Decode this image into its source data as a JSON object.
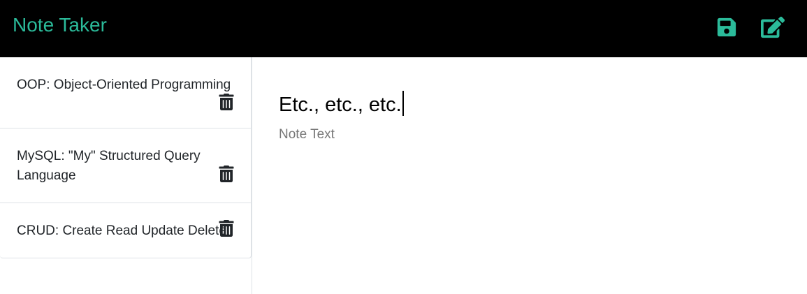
{
  "header": {
    "title": "Note Taker",
    "save_icon": "save-icon",
    "new_icon": "pen-square-icon",
    "accent_color": "#2bbb9a"
  },
  "sidebar": {
    "notes": [
      {
        "title": "OOP: Object-Oriented Programming",
        "delete_icon": "trash-icon"
      },
      {
        "title": "MySQL: \"My\" Structured Query Language",
        "delete_icon": "trash-icon"
      },
      {
        "title": "CRUD: Create Read Update Delete",
        "delete_icon": "trash-icon"
      }
    ]
  },
  "editor": {
    "title_value": "Etc., etc., etc.",
    "text_placeholder": "Note Text",
    "text_value": ""
  }
}
